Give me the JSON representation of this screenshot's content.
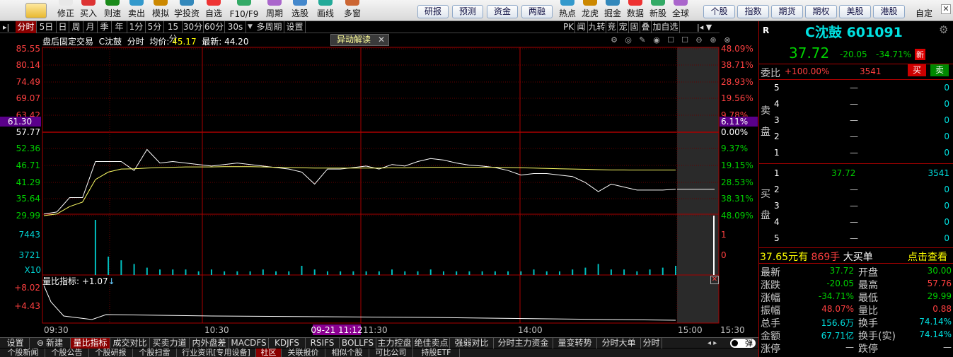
{
  "toolbar": {
    "icon_items": [
      "修正",
      "买入",
      "则速",
      "卖出",
      "模拟",
      "学投资",
      "自选",
      "F10/F9",
      "周期",
      "选股",
      "画线",
      "多窗"
    ],
    "tab_buttons": [
      "研报",
      "预测",
      "资金",
      "两融"
    ],
    "icon_items2": [
      "热点",
      "龙虎",
      "掘金",
      "数据",
      "新股",
      "全球"
    ],
    "tab_buttons2": [
      "个股",
      "指数",
      "期货",
      "期权",
      "美股",
      "港股"
    ],
    "custom": "自定"
  },
  "period_tabs": [
    "分时",
    "5日",
    "日",
    "周",
    "月",
    "季",
    "年",
    "1分",
    "5分",
    "15分",
    "30分",
    "60分",
    "30s",
    "多周期",
    "设置"
  ],
  "right_tabs": [
    "PK",
    "闻",
    "九转",
    "竞",
    "宠",
    "固",
    "叠",
    "加自选"
  ],
  "chart": {
    "header": "盘后固定交易",
    "stock": "C沈鼓",
    "mode": "分时",
    "avg_label": "均价:",
    "avg_value": "45.17",
    "last_label": "最新:",
    "last_value": "44.20",
    "badge": "异动解读",
    "left_ticks": [
      "85.55",
      "80.14",
      "74.49",
      "69.07",
      "63.42",
      "61.30",
      "57.77",
      "52.36",
      "46.71",
      "41.29",
      "35.64",
      "29.99"
    ],
    "right_ticks": [
      "48.09%",
      "38.71%",
      "28.93%",
      "19.56%",
      "9.78%",
      "6.11%",
      "0.00%",
      "9.37%",
      "19.15%",
      "28.53%",
      "38.31%",
      "48.09%"
    ],
    "vol_left": [
      "7443",
      "3721",
      "X10"
    ],
    "vol_right": [
      "1",
      "0"
    ],
    "indicator_label": "量比指标: +1.07",
    "ind_ticks": [
      "+8.02",
      "+4.43"
    ],
    "time_labels": [
      "09:30",
      "10:30",
      "11:30",
      "14:00",
      "15:00",
      "15:30"
    ],
    "cursor_time": "09-21 11:12"
  },
  "chart_data": {
    "type": "line",
    "series": [
      {
        "name": "最新",
        "values": [
          30.5,
          31.2,
          36.0,
          36.0,
          48.0,
          48.0,
          48.0,
          45.0,
          52.0,
          47.5,
          48.0,
          47.5,
          47.0,
          46.5,
          47.0,
          47.5,
          47.0,
          46.5,
          46.0,
          45.5,
          44.5,
          40.5,
          45.5,
          45.5,
          46.0,
          46.5,
          45.5,
          47.0,
          46.5,
          48.0,
          49.0,
          48.5,
          47.5,
          46.8,
          46.5,
          46.0,
          45.0,
          43.5,
          44.0,
          44.0,
          43.5,
          43.0,
          41.0,
          38.0,
          40.5,
          39.5,
          38.5,
          38.5,
          38.5,
          38.8
        ]
      },
      {
        "name": "均价",
        "values": [
          30.0,
          30.5,
          33.0,
          34.5,
          42.0,
          44.5,
          45.5,
          45.6,
          45.8,
          46.0,
          46.1,
          46.2,
          46.2,
          46.2,
          46.3,
          46.3,
          46.3,
          46.2,
          46.1,
          46.0,
          45.9,
          45.8,
          45.8,
          45.8,
          45.8,
          45.8,
          45.8,
          45.9,
          45.9,
          46.0,
          46.1,
          46.1,
          46.1,
          46.1,
          46.1,
          46.1,
          46.0,
          45.9,
          45.8,
          45.7,
          45.6,
          45.5,
          45.4,
          45.3,
          45.2,
          45.2,
          45.17,
          45.17,
          45.17,
          45.17
        ]
      }
    ],
    "volume": [
      0,
      0,
      0,
      0,
      30,
      10,
      8,
      6,
      4,
      3,
      3,
      3,
      2,
      3,
      2,
      2,
      2,
      3,
      2,
      2,
      5,
      3,
      2,
      2,
      2,
      2,
      2,
      3,
      2,
      2,
      3,
      2,
      2,
      2,
      2,
      2,
      2,
      2,
      3,
      2,
      2,
      3,
      4,
      6,
      3,
      3,
      2,
      3,
      4,
      5
    ],
    "ylim": [
      29.99,
      85.55
    ]
  },
  "quote": {
    "r": "R",
    "name": "C沈鼓",
    "code": "601091",
    "price": "37.72",
    "change": "-20.05",
    "pct": "-34.71%",
    "new_badge": "新",
    "weibi_label": "委比",
    "weibi_value": "+100.00%",
    "weibi_vol": "3541",
    "buy_btn": "买",
    "sell_btn": "卖",
    "sell_label": "卖盘",
    "buy_label": "买盘",
    "asks": [
      {
        "lvl": "5",
        "px": "—",
        "vol": "0"
      },
      {
        "lvl": "4",
        "px": "—",
        "vol": "0"
      },
      {
        "lvl": "3",
        "px": "—",
        "vol": "0"
      },
      {
        "lvl": "2",
        "px": "—",
        "vol": "0"
      },
      {
        "lvl": "1",
        "px": "—",
        "vol": "0"
      }
    ],
    "bids": [
      {
        "lvl": "1",
        "px": "37.72",
        "vol": "3541"
      },
      {
        "lvl": "2",
        "px": "—",
        "vol": "0"
      },
      {
        "lvl": "3",
        "px": "—",
        "vol": "0"
      },
      {
        "lvl": "4",
        "px": "—",
        "vol": "0"
      },
      {
        "lvl": "5",
        "px": "—",
        "vol": "0"
      }
    ],
    "big_order_price": "37.65元有",
    "big_order_vol": "869手",
    "big_order_label": "大买单",
    "big_order_link": "点击查看",
    "stats": [
      {
        "l": "最新",
        "v": "37.72",
        "l2": "开盘",
        "v2": "30.00"
      },
      {
        "l": "涨跌",
        "v": "-20.05",
        "l2": "最高",
        "v2": "57.76"
      },
      {
        "l": "涨幅",
        "v": "-34.71%",
        "l2": "最低",
        "v2": "29.99"
      },
      {
        "l": "振幅",
        "v": "48.07%",
        "l2": "量比",
        "v2": "0.88"
      },
      {
        "l": "总手",
        "v": "156.6万",
        "l2": "换手",
        "v2": "74.14%"
      },
      {
        "l": "金额",
        "v": "67.71亿",
        "l2": "换手(实)",
        "v2": "74.14%"
      },
      {
        "l": "涨停",
        "v": "—",
        "l2": "跌停",
        "v2": "—"
      }
    ]
  },
  "bottom_tabs": [
    "设置",
    "新建",
    "量比指标",
    "成交对比",
    "买卖力道",
    "内外盘差",
    "MACDFS",
    "KDJFS",
    "RSIFS",
    "BOLLFS",
    "主力控盘",
    "绝佳卖点",
    "强弱对比",
    "分时主力资金",
    "量变转势",
    "分时大单",
    "分时"
  ],
  "bottom_tabs2": [
    "个股新闻",
    "个股公告",
    "个股研报",
    "个股扫雷",
    "行业资讯[专用设备]",
    "社区",
    "关联报价",
    "相似个股",
    "可比公司",
    "持股ETF"
  ],
  "toggle": "弹"
}
